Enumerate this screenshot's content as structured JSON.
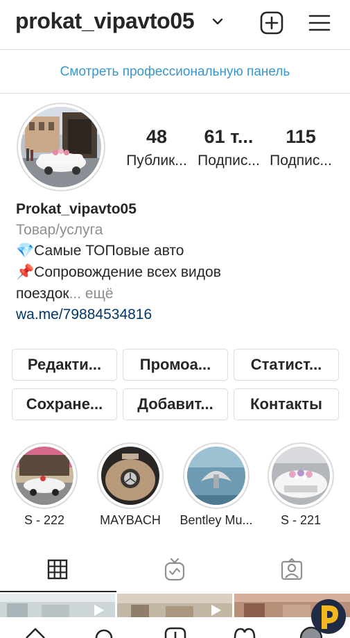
{
  "header": {
    "username": "prokat_vipavto05"
  },
  "banner": {
    "label": "Смотреть профессиональную панель"
  },
  "stats": [
    {
      "value": "48",
      "label": "Публик..."
    },
    {
      "value": "61 т...",
      "label": "Подпис..."
    },
    {
      "value": "115",
      "label": "Подпис..."
    }
  ],
  "bio": {
    "name": "Prokat_vipavto05",
    "category": "Товар/услуга",
    "line1": "💎Самые ТОПовые авто",
    "line2": "📌Сопровождение всех видов",
    "line3": "поездок",
    "more": "... ещё",
    "link": "wa.me/79884534816"
  },
  "buttons": [
    {
      "label": "Редакти..."
    },
    {
      "label": "Промоа..."
    },
    {
      "label": "Статист..."
    },
    {
      "label": "Сохране..."
    },
    {
      "label": "Добавит..."
    },
    {
      "label": "Контакты"
    }
  ],
  "highlights": [
    {
      "label": "S - 222"
    },
    {
      "label": "MAYBACH"
    },
    {
      "label": "Bentley Mu..."
    },
    {
      "label": "S - 221"
    }
  ],
  "tabs": [
    {
      "icon": "grid-icon",
      "active": true
    },
    {
      "icon": "igtv-icon",
      "active": false
    },
    {
      "icon": "tagged-icon",
      "active": false
    }
  ],
  "colors": {
    "link": "#00376b",
    "banner_link": "#3897c9",
    "border": "#dbdbdb",
    "muted": "#8e8e8e"
  }
}
